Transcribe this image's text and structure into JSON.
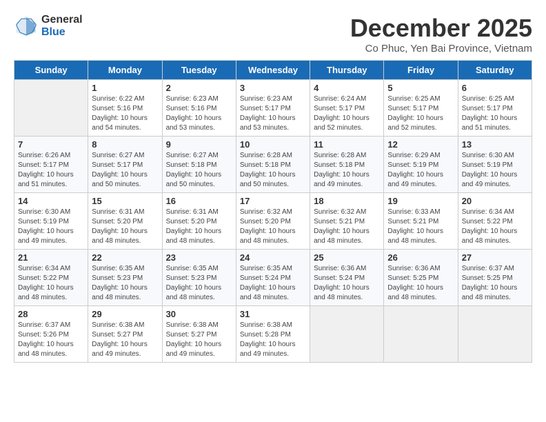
{
  "logo": {
    "general": "General",
    "blue": "Blue"
  },
  "header": {
    "month": "December 2025",
    "location": "Co Phuc, Yen Bai Province, Vietnam"
  },
  "days_of_week": [
    "Sunday",
    "Monday",
    "Tuesday",
    "Wednesday",
    "Thursday",
    "Friday",
    "Saturday"
  ],
  "weeks": [
    [
      {
        "day": "",
        "sunrise": "",
        "sunset": "",
        "daylight": ""
      },
      {
        "day": "1",
        "sunrise": "Sunrise: 6:22 AM",
        "sunset": "Sunset: 5:16 PM",
        "daylight": "Daylight: 10 hours and 54 minutes."
      },
      {
        "day": "2",
        "sunrise": "Sunrise: 6:23 AM",
        "sunset": "Sunset: 5:16 PM",
        "daylight": "Daylight: 10 hours and 53 minutes."
      },
      {
        "day": "3",
        "sunrise": "Sunrise: 6:23 AM",
        "sunset": "Sunset: 5:17 PM",
        "daylight": "Daylight: 10 hours and 53 minutes."
      },
      {
        "day": "4",
        "sunrise": "Sunrise: 6:24 AM",
        "sunset": "Sunset: 5:17 PM",
        "daylight": "Daylight: 10 hours and 52 minutes."
      },
      {
        "day": "5",
        "sunrise": "Sunrise: 6:25 AM",
        "sunset": "Sunset: 5:17 PM",
        "daylight": "Daylight: 10 hours and 52 minutes."
      },
      {
        "day": "6",
        "sunrise": "Sunrise: 6:25 AM",
        "sunset": "Sunset: 5:17 PM",
        "daylight": "Daylight: 10 hours and 51 minutes."
      }
    ],
    [
      {
        "day": "7",
        "sunrise": "Sunrise: 6:26 AM",
        "sunset": "Sunset: 5:17 PM",
        "daylight": "Daylight: 10 hours and 51 minutes."
      },
      {
        "day": "8",
        "sunrise": "Sunrise: 6:27 AM",
        "sunset": "Sunset: 5:17 PM",
        "daylight": "Daylight: 10 hours and 50 minutes."
      },
      {
        "day": "9",
        "sunrise": "Sunrise: 6:27 AM",
        "sunset": "Sunset: 5:18 PM",
        "daylight": "Daylight: 10 hours and 50 minutes."
      },
      {
        "day": "10",
        "sunrise": "Sunrise: 6:28 AM",
        "sunset": "Sunset: 5:18 PM",
        "daylight": "Daylight: 10 hours and 50 minutes."
      },
      {
        "day": "11",
        "sunrise": "Sunrise: 6:28 AM",
        "sunset": "Sunset: 5:18 PM",
        "daylight": "Daylight: 10 hours and 49 minutes."
      },
      {
        "day": "12",
        "sunrise": "Sunrise: 6:29 AM",
        "sunset": "Sunset: 5:19 PM",
        "daylight": "Daylight: 10 hours and 49 minutes."
      },
      {
        "day": "13",
        "sunrise": "Sunrise: 6:30 AM",
        "sunset": "Sunset: 5:19 PM",
        "daylight": "Daylight: 10 hours and 49 minutes."
      }
    ],
    [
      {
        "day": "14",
        "sunrise": "Sunrise: 6:30 AM",
        "sunset": "Sunset: 5:19 PM",
        "daylight": "Daylight: 10 hours and 49 minutes."
      },
      {
        "day": "15",
        "sunrise": "Sunrise: 6:31 AM",
        "sunset": "Sunset: 5:20 PM",
        "daylight": "Daylight: 10 hours and 48 minutes."
      },
      {
        "day": "16",
        "sunrise": "Sunrise: 6:31 AM",
        "sunset": "Sunset: 5:20 PM",
        "daylight": "Daylight: 10 hours and 48 minutes."
      },
      {
        "day": "17",
        "sunrise": "Sunrise: 6:32 AM",
        "sunset": "Sunset: 5:20 PM",
        "daylight": "Daylight: 10 hours and 48 minutes."
      },
      {
        "day": "18",
        "sunrise": "Sunrise: 6:32 AM",
        "sunset": "Sunset: 5:21 PM",
        "daylight": "Daylight: 10 hours and 48 minutes."
      },
      {
        "day": "19",
        "sunrise": "Sunrise: 6:33 AM",
        "sunset": "Sunset: 5:21 PM",
        "daylight": "Daylight: 10 hours and 48 minutes."
      },
      {
        "day": "20",
        "sunrise": "Sunrise: 6:34 AM",
        "sunset": "Sunset: 5:22 PM",
        "daylight": "Daylight: 10 hours and 48 minutes."
      }
    ],
    [
      {
        "day": "21",
        "sunrise": "Sunrise: 6:34 AM",
        "sunset": "Sunset: 5:22 PM",
        "daylight": "Daylight: 10 hours and 48 minutes."
      },
      {
        "day": "22",
        "sunrise": "Sunrise: 6:35 AM",
        "sunset": "Sunset: 5:23 PM",
        "daylight": "Daylight: 10 hours and 48 minutes."
      },
      {
        "day": "23",
        "sunrise": "Sunrise: 6:35 AM",
        "sunset": "Sunset: 5:23 PM",
        "daylight": "Daylight: 10 hours and 48 minutes."
      },
      {
        "day": "24",
        "sunrise": "Sunrise: 6:35 AM",
        "sunset": "Sunset: 5:24 PM",
        "daylight": "Daylight: 10 hours and 48 minutes."
      },
      {
        "day": "25",
        "sunrise": "Sunrise: 6:36 AM",
        "sunset": "Sunset: 5:24 PM",
        "daylight": "Daylight: 10 hours and 48 minutes."
      },
      {
        "day": "26",
        "sunrise": "Sunrise: 6:36 AM",
        "sunset": "Sunset: 5:25 PM",
        "daylight": "Daylight: 10 hours and 48 minutes."
      },
      {
        "day": "27",
        "sunrise": "Sunrise: 6:37 AM",
        "sunset": "Sunset: 5:25 PM",
        "daylight": "Daylight: 10 hours and 48 minutes."
      }
    ],
    [
      {
        "day": "28",
        "sunrise": "Sunrise: 6:37 AM",
        "sunset": "Sunset: 5:26 PM",
        "daylight": "Daylight: 10 hours and 48 minutes."
      },
      {
        "day": "29",
        "sunrise": "Sunrise: 6:38 AM",
        "sunset": "Sunset: 5:27 PM",
        "daylight": "Daylight: 10 hours and 49 minutes."
      },
      {
        "day": "30",
        "sunrise": "Sunrise: 6:38 AM",
        "sunset": "Sunset: 5:27 PM",
        "daylight": "Daylight: 10 hours and 49 minutes."
      },
      {
        "day": "31",
        "sunrise": "Sunrise: 6:38 AM",
        "sunset": "Sunset: 5:28 PM",
        "daylight": "Daylight: 10 hours and 49 minutes."
      },
      {
        "day": "",
        "sunrise": "",
        "sunset": "",
        "daylight": ""
      },
      {
        "day": "",
        "sunrise": "",
        "sunset": "",
        "daylight": ""
      },
      {
        "day": "",
        "sunrise": "",
        "sunset": "",
        "daylight": ""
      }
    ]
  ]
}
